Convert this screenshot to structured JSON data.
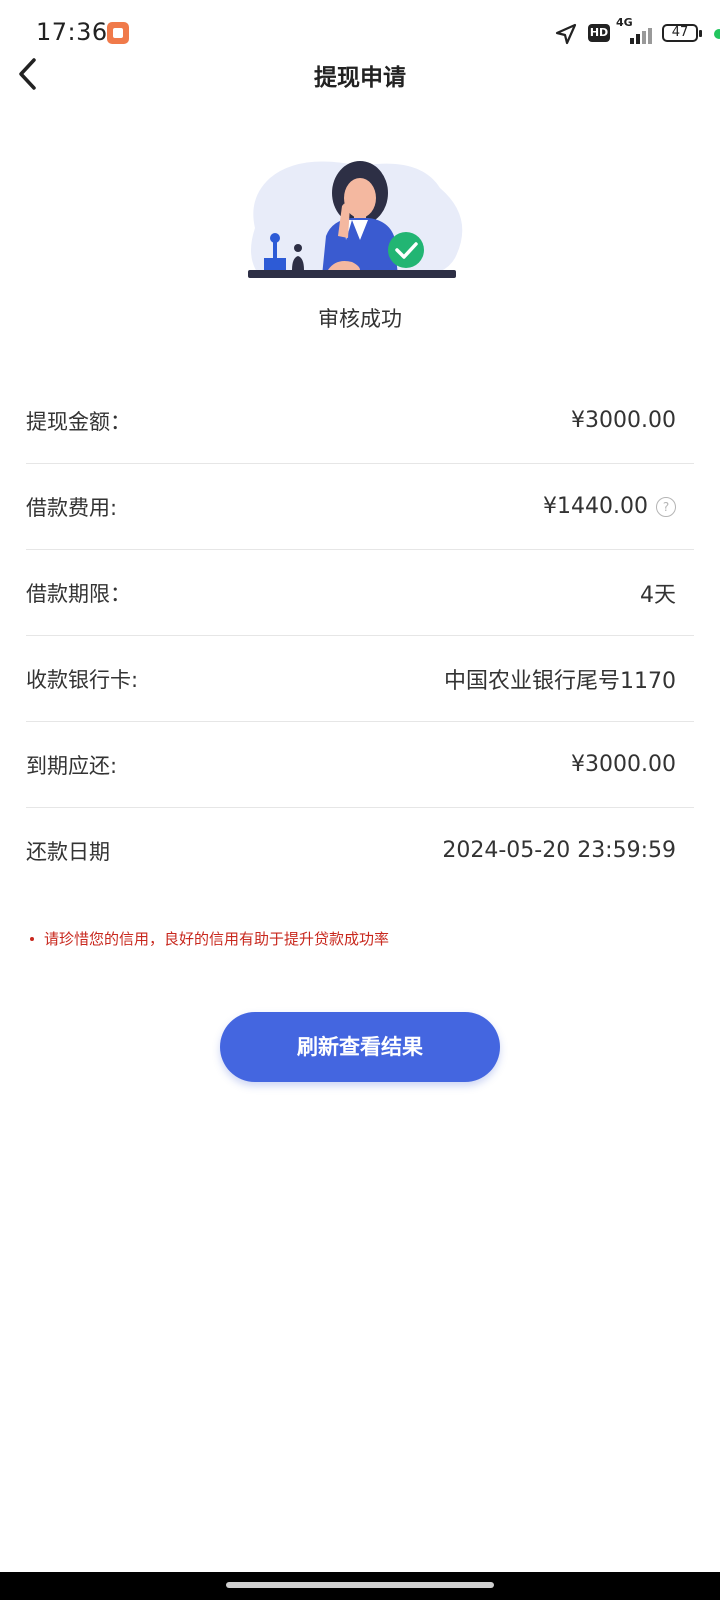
{
  "status_bar": {
    "time": "17:36",
    "hd": "HD",
    "network": "4G",
    "battery": "47"
  },
  "header": {
    "title": "提现申请"
  },
  "result": {
    "status_text": "审核成功"
  },
  "details": {
    "rows": [
      {
        "label": "提现金额：",
        "value": "¥3000.00"
      },
      {
        "label": "借款费用:",
        "value": "¥1440.00",
        "help": "?"
      },
      {
        "label": "借款期限：",
        "value": "4天"
      },
      {
        "label": "收款银行卡:",
        "value": "中国农业银行尾号1170"
      },
      {
        "label": "到期应还:",
        "value": "¥3000.00"
      },
      {
        "label": "还款日期",
        "value": "2024-05-20 23:59:59"
      }
    ]
  },
  "notice": {
    "text": "请珍惜您的信用，良好的信用有助于提升贷款成功率"
  },
  "actions": {
    "refresh_label": "刷新查看结果"
  },
  "colors": {
    "accent": "#4466e0",
    "notice": "#c8281e",
    "success": "#22b573"
  }
}
